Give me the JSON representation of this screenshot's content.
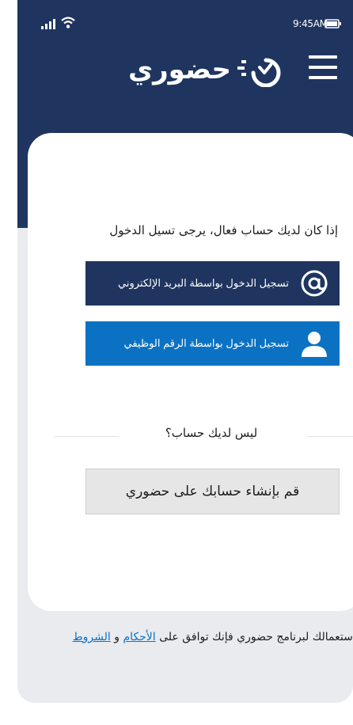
{
  "status_bar": {
    "time": "9:45AM"
  },
  "header": {
    "logo_text": "حضوري",
    "menu_icon": "hamburger-menu-icon"
  },
  "login": {
    "prompt": "إذا كان لديك حساب فعال، يرجى تسيل الدخول",
    "email_button": "تسجيل الدخول بواسطة البريد الإلكتروني",
    "employee_button": "تسجيل الدخول بواسطة الرقم الوظيفي"
  },
  "signup": {
    "no_account": "ليس لديك حساب؟",
    "create_button": "قم بإنشاء حسابك على حضوري"
  },
  "terms": {
    "text": "باستعمالك لبرنامج حضوري فإنك توافق على",
    "terms_link": "الأحكام",
    "conjunction": "و",
    "conditions_link": "الشروط"
  },
  "colors": {
    "header_bg": "#1f355f",
    "email_button_bg": "#1f355f",
    "employee_button_bg": "#0b72c3",
    "link": "#0b72c3",
    "page_bg": "#e9ebef"
  }
}
